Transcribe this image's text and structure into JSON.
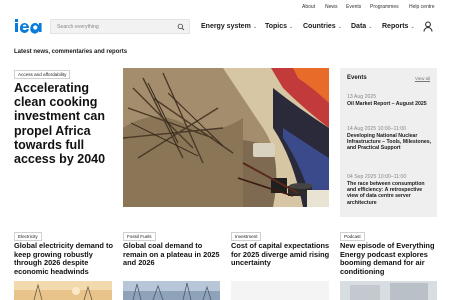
{
  "topbar": {
    "links": [
      "About",
      "News",
      "Events",
      "Programmes",
      "Help centre"
    ]
  },
  "logo": {
    "text": "iea",
    "color": "#0a7bd6"
  },
  "search": {
    "placeholder": "Search everything",
    "icon": "search-icon"
  },
  "nav": {
    "items": [
      {
        "label": "Energy system",
        "chevron": "⌄"
      },
      {
        "label": "Topics",
        "chevron": "⌄"
      },
      {
        "label": "Countries",
        "chevron": "⌄"
      },
      {
        "label": "Data",
        "chevron": "⌄"
      },
      {
        "label": "Reports",
        "chevron": "⌄"
      }
    ],
    "account_icon": "user-icon"
  },
  "section": {
    "heading": "Latest news, commentaries and reports"
  },
  "hero": {
    "tag": "Access and affordability",
    "title": "Accelerating clean cooking investment can propel Africa towards full access by 2040"
  },
  "events": {
    "heading": "Events",
    "view_all": "View all",
    "items": [
      {
        "date": "13 Aug 2025",
        "title": "Oil Market Report – August 2025"
      },
      {
        "date": "14 Aug 2025 10:00–11:00",
        "title": "Developing National Nuclear Infrastructure – Tools, Milestones, and Practical Support"
      },
      {
        "date": "04 Sep 2025 10:00–11:00",
        "title": "The race between consumption and efficiency: A retrospective view of data centre server architecture"
      }
    ]
  },
  "cards": [
    {
      "tag": "Electricity",
      "title": "Global electricity demand to keep growing robustly through 2026 despite economic headwinds"
    },
    {
      "tag": "Fossil Fuels",
      "title": "Global coal demand to remain on a plateau in 2025 and 2026"
    },
    {
      "tag": "Investment",
      "title": "Cost of capital expectations for 2025 diverge amid rising uncertainty"
    },
    {
      "tag": "Podcast",
      "title": "New episode of Everything Energy podcast explores booming demand for air conditioning"
    }
  ],
  "colors": {
    "accent": "#0a7bd6",
    "events_bg": "#efefef",
    "search_bg": "#f2f2f2"
  }
}
